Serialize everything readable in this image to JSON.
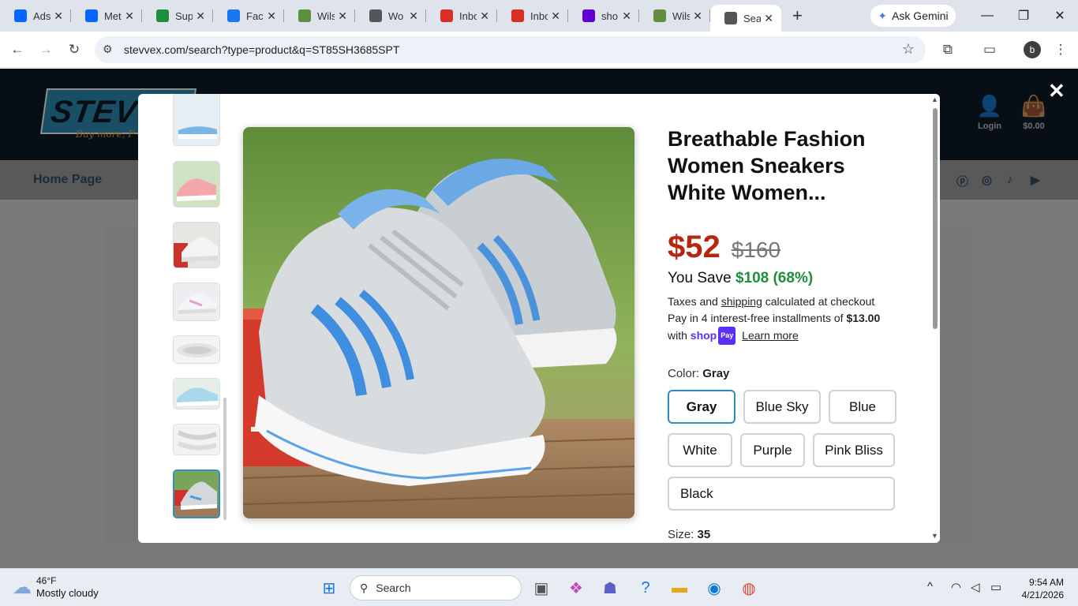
{
  "browser": {
    "tabs": [
      {
        "title": "Ads",
        "icon": "meta-icon",
        "color": "#0866ff"
      },
      {
        "title": "Met",
        "icon": "meta-icon",
        "color": "#0866ff"
      },
      {
        "title": "Sup",
        "icon": "sheet-icon",
        "color": "#1e8e3e"
      },
      {
        "title": "Face",
        "icon": "facebook-icon",
        "color": "#1877f2"
      },
      {
        "title": "Wils",
        "icon": "shopify-icon",
        "color": "#5e8e3e"
      },
      {
        "title": "Wo",
        "icon": "globe-icon",
        "color": "#555555"
      },
      {
        "title": "Inbo",
        "icon": "gmail-icon",
        "color": "#d93025"
      },
      {
        "title": "Inbo",
        "icon": "gmail-icon",
        "color": "#d93025"
      },
      {
        "title": "sho",
        "icon": "yahoo-icon",
        "color": "#6001d2"
      },
      {
        "title": "Wils",
        "icon": "shopify-icon",
        "color": "#5e8e3e"
      },
      {
        "title": "Sea",
        "icon": "globe-icon",
        "color": "#555555",
        "active": true
      }
    ],
    "ask_gemini": "Ask Gemini",
    "url": "stevvex.com/search?type=product&q=ST85SH3685SPT",
    "profile_initial": "b"
  },
  "site": {
    "logo_text": "STEVVEX",
    "logo_tagline": "Buy more, P",
    "login_label": "Login",
    "cart_total": "$0.00",
    "nav_home": "Home Page"
  },
  "product": {
    "title": "Breathable Fashion Women Sneakers White Women...",
    "price": "$52",
    "compare_price": "$160",
    "you_save_label": "You Save",
    "you_save_value": "$108 (68%)",
    "tax_pre": "Taxes and",
    "tax_link": "shipping",
    "tax_post": "calculated at checkout",
    "installments_pre": "Pay in 4 interest-free installments of",
    "installments_amount": "$13.00",
    "installments_with": "with",
    "shop_label": "shop",
    "pay_label": "Pay",
    "learn_more": "Learn more",
    "color_label": "Color:",
    "color_selected": "Gray",
    "colors": [
      "Gray",
      "Blue Sky",
      "Blue",
      "White",
      "Purple",
      "Pink Bliss",
      "Black"
    ],
    "size_label": "Size:",
    "size_selected": "35"
  },
  "taskbar": {
    "temp": "46°F",
    "condition": "Mostly cloudy",
    "search_placeholder": "Search",
    "time": "9:54 AM",
    "date": "4/21/2026"
  }
}
